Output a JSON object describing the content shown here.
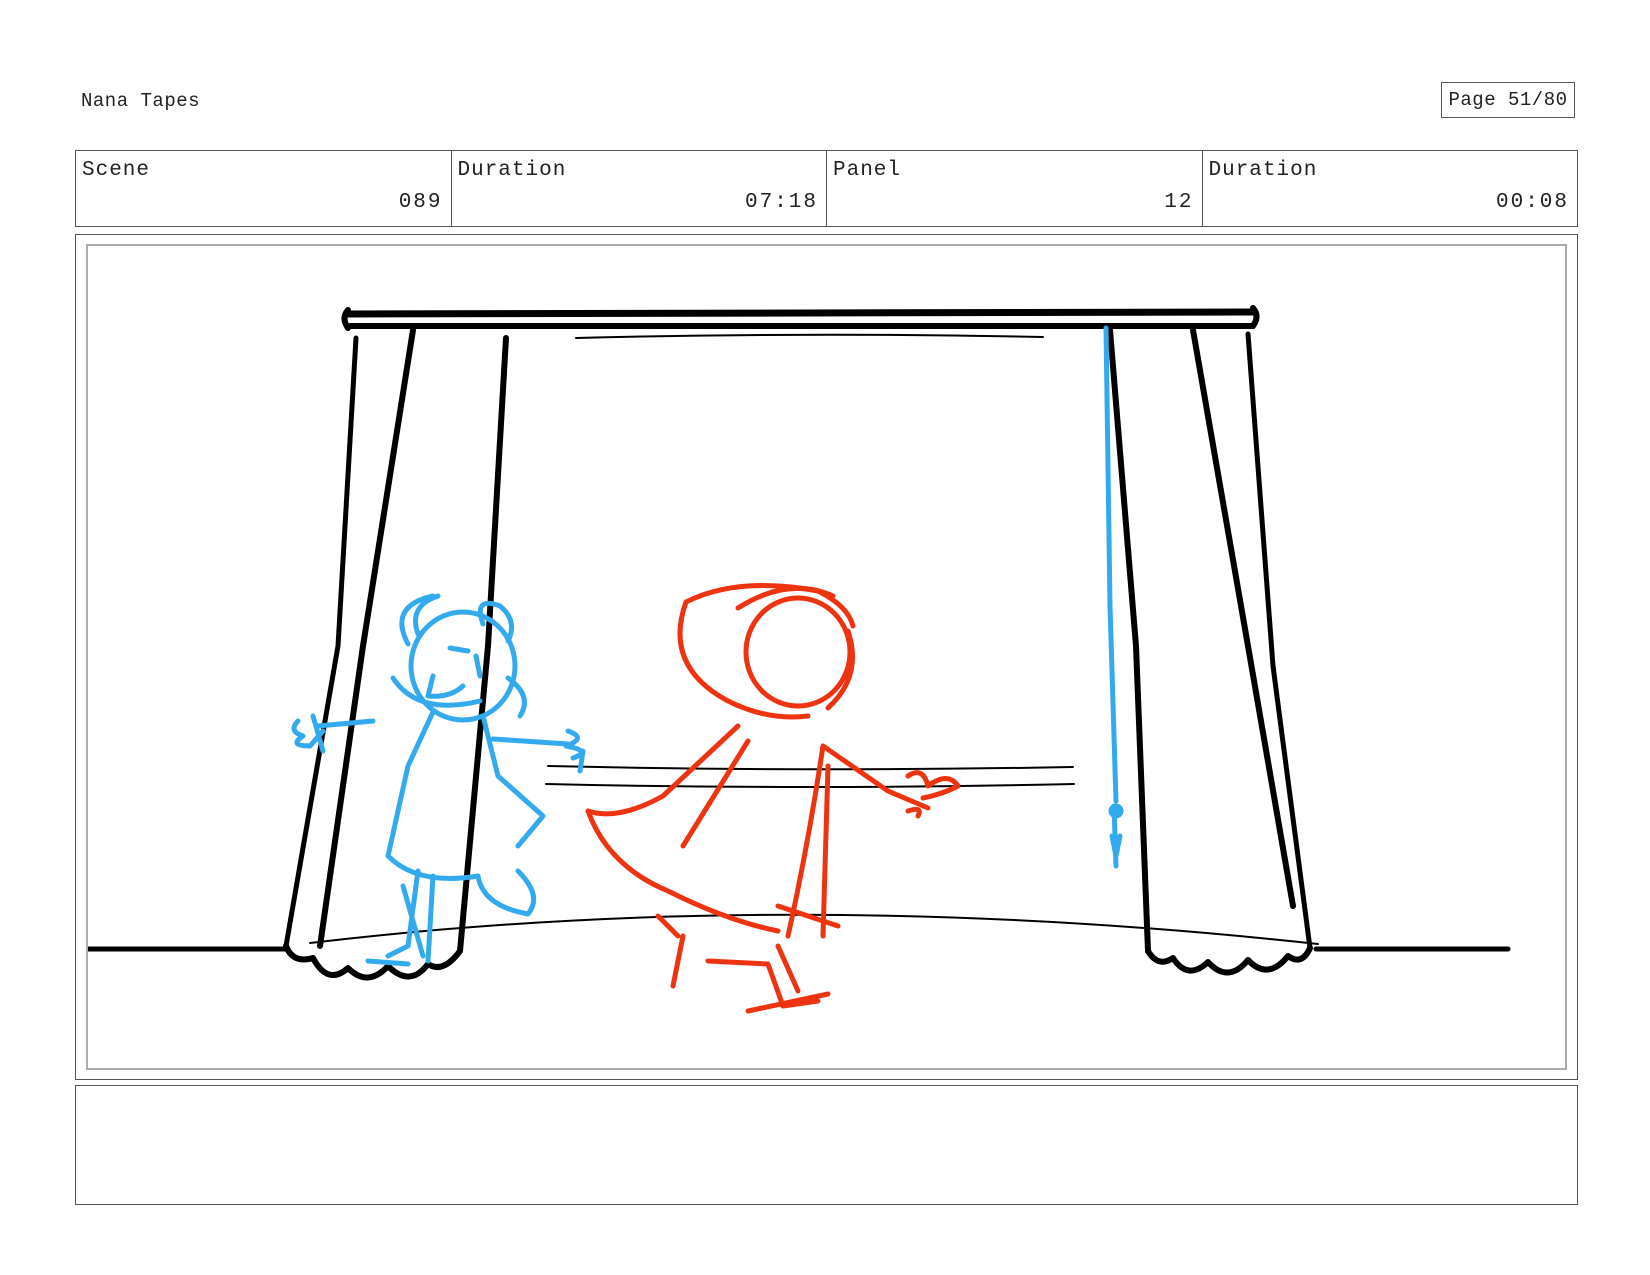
{
  "header": {
    "project_title": "Nana Tapes",
    "page_label": "Page 51/80"
  },
  "info": {
    "scene_label": "Scene",
    "scene_value": "089",
    "scene_duration_label": "Duration",
    "scene_duration_value": "07:18",
    "panel_label": "Panel",
    "panel_value": "12",
    "panel_duration_label": "Duration",
    "panel_duration_value": "00:08"
  },
  "drawing": {
    "description_icons": [
      "curtain-stage",
      "blue-character",
      "red-hooded-character"
    ],
    "colors": {
      "ink": "#000000",
      "blue_character": "#33aaee",
      "red_character": "#ee3311",
      "frame_border": "#aaaaaa"
    }
  },
  "notes": {
    "text": ""
  }
}
